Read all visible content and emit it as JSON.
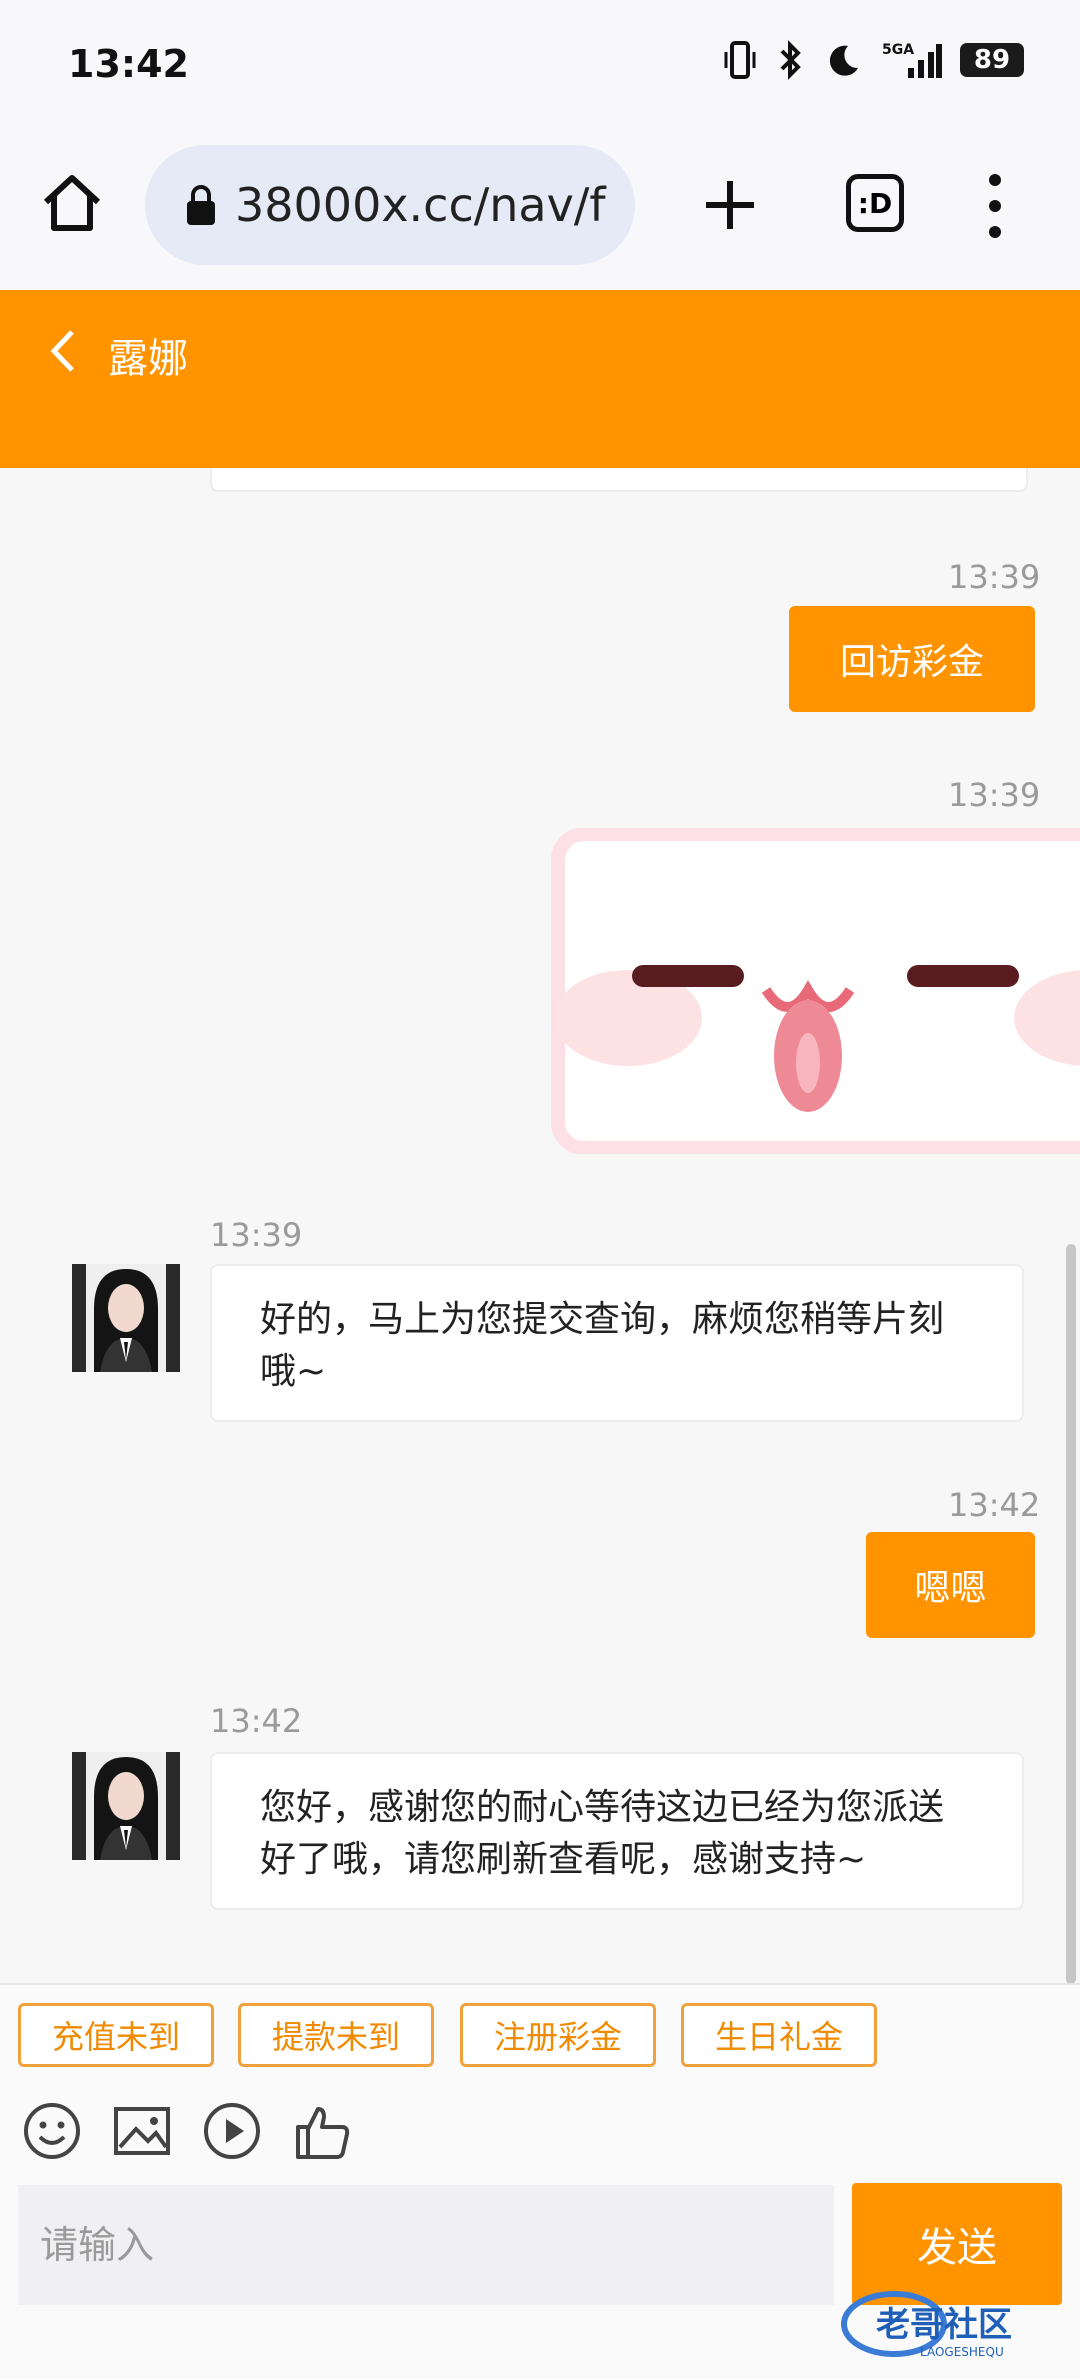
{
  "status_bar": {
    "time": "13:42",
    "signal": "5GA",
    "battery": "89"
  },
  "browser": {
    "url": "38000x.cc/nav/f",
    "tabs_label": ":D"
  },
  "header": {
    "title": "露娜"
  },
  "messages": [
    {
      "time": "13:39",
      "direction": "out",
      "text": "回访彩金"
    },
    {
      "time": "13:39",
      "direction": "out",
      "type": "sticker"
    },
    {
      "time": "13:39",
      "direction": "in",
      "text": "好的，马上为您提交查询，麻烦您稍等片刻哦~"
    },
    {
      "time": "13:42",
      "direction": "out",
      "text": "嗯嗯"
    },
    {
      "time": "13:42",
      "direction": "in",
      "text": "您好，感谢您的耐心等待这边已经为您派送好了哦，请您刷新查看呢，感谢支持~"
    }
  ],
  "quick_replies": [
    "充值未到",
    "提款未到",
    "注册彩金",
    "生日礼金"
  ],
  "input": {
    "placeholder": "请输入"
  },
  "send_label": "发送",
  "watermark": {
    "text": "老哥社区",
    "sub": "LAOGESHEQU"
  },
  "colors": {
    "accent": "#ff9400",
    "quick_border": "#f0a13a"
  }
}
